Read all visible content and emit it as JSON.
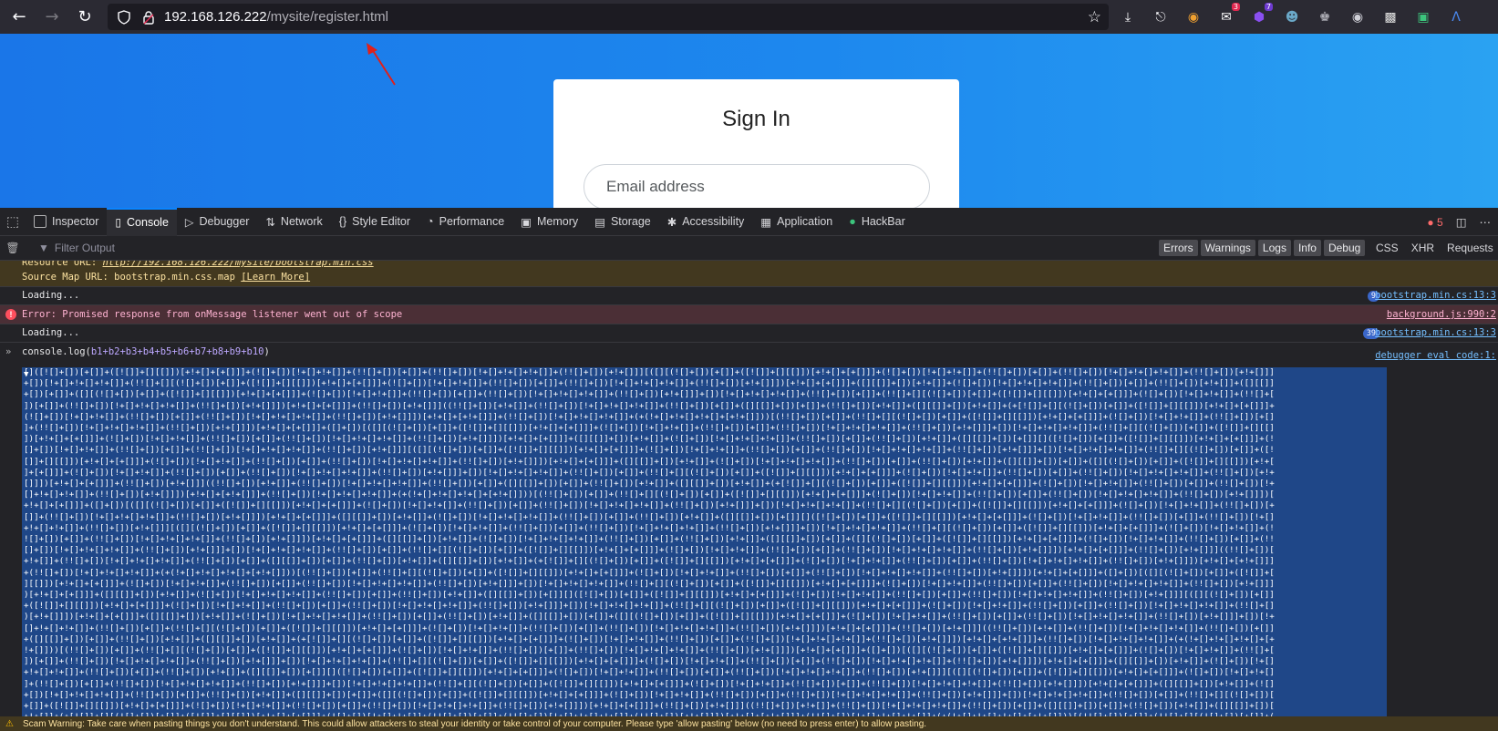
{
  "browser": {
    "url_host": "192.168.126.222",
    "url_path": "/mysite/register.html",
    "extensions": [
      {
        "icon": "fox-icon"
      },
      {
        "icon": "mail-icon",
        "badge": "3"
      },
      {
        "icon": "shield-icon",
        "badge": "7"
      },
      {
        "icon": "mask-icon"
      },
      {
        "icon": "puzzle-icon"
      },
      {
        "icon": "globe-icon"
      },
      {
        "icon": "cookie-icon"
      },
      {
        "icon": "code-icon"
      },
      {
        "icon": "translate-icon"
      }
    ]
  },
  "page": {
    "card_title": "Sign In",
    "email_placeholder": "Email address"
  },
  "devtools": {
    "tabs": [
      "Inspector",
      "Console",
      "Debugger",
      "Network",
      "Style Editor",
      "Performance",
      "Memory",
      "Storage",
      "Accessibility",
      "Application",
      "HackBar"
    ],
    "active_tab": "Console",
    "error_count": "5",
    "filter_placeholder": "Filter Output",
    "levels": [
      "Errors",
      "Warnings",
      "Logs",
      "Info",
      "Debug"
    ],
    "net_filters": [
      "CSS",
      "XHR",
      "Requests"
    ]
  },
  "console": {
    "warn_line1_label": "Resource URL: ",
    "warn_line1_url": "http://192.168.126.222/mysite/bootstrap.min.css",
    "warn_line2": "Source Map URL: bootstrap.min.css.map ",
    "warn_learn_more": "[Learn More]",
    "loading1": "Loading...",
    "loading1_count": "9",
    "loading1_src": "bootstrap.min.cs:13:3",
    "error_msg": "Error: Promised response from onMessage listener went out of scope",
    "error_src": "background.js:990:2",
    "loading2": "Loading...",
    "loading2_count": "39",
    "loading2_src": "bootstrap.min.cs:13:3",
    "command_fn": "console.log(",
    "command_args": "b1+b2+b3+b4+b5+b6+b7+b8+b9+b10",
    "command_close": ")",
    "output_src": "debugger eval code:1:",
    "output_text": "[]([![]+[])[+[]]+([![]]+[][[]])[+!+[]+[+[]]]+(![]+[])[!+[]+!+[]]+(!![]+[])[+[]]+(!![]+[])[!+[]+!+[]+!+[]]+(!![]+[])[+!+[]]][([][(![]+[])[+[]]+([![]]+[][[]])[+!+[]+[+[]]]+(![]+[])[!+[]+!+[]]+(!![]+[])[+[]]+(!![]+[])[!+[]+!+[]+!+[]]+(!![]+[])[+!+[]]]+[])[!+[]+!+[]+!+[]]+(!![]+[][(![]+[])[+[]]+([![]]+[][[]])[+!+[]+[+[]]]+(![]+[])[!+[]+!+[]]+(!![]+[])[+[]]+(!![]+[])[!+[]+!+[]+!+[]]+(!![]+[])[+!+[]]])[+!+[]+[+[]]]+([][[]]+[])[+!+[]]+(![]+[])[!+[]+!+[]+!+[]]+(!![]+[])[+[]]+(!![]+[])[+!+[]]+([][[]]+[])[+[]]+([][(![]+[])[+[]]+([![]]+[][[]])[+!+[]+[+[]]]+(![]+[])[!+[]+!+[]]+(!![]+[])[+[]]+(!![]+[])[!+[]+!+[]+!+[]]+(!![]+[])[+!+[]]]+[])[!+[]+!+[]+!+[]]+(!![]+[])[+[]]+(!![]+[][(![]+[])[+[]]+([![]]+[][[]])[+!+[]+[+[]]]+(![]+[])[!+[]+!+[]]+(!![]+[])[+[]]+(!![]+[])[!+[]+!+[]+!+[]]+(!![]+[])[+!+[]]])[+!+[]+[+[]]]+(!![]+[])[+!+[]]]((!![]+[])[+!+[]]+(!![]+[])[!+[]+!+[]+!+[]]+(!![]+[])[+[]]+([][[]]+[])[+[]]+(!![]+[])[+!+[]]+([][[]]+[])[+!+[]]+(+[![]]+[][(![]+[])[+[]]+([![]]+[][[]])[+!+[]+[+[]]]+(![]+[])[!+[]+!+[]]+(!![]+[])[+[]]+(!![]+[])[!+[]+!+[]+!+[]]+(!![]+[])[+!+[]]])[+!+[]+[+!+[]]]+(!![]+[])[!+[]+!+[]+!+[]]+(+(!+[]+!+[]+!+[]+[+!+[]]))[(!![]+[])[+[]]+(!![]+[][(![]+[])[+[]]+([![]]+[][[]])[+!+[]+[+[]]]+(![]+[])[!+[]+!+[]]+(!![]+[])[+[]]+(!![]+[])[!+[]+!+[]+!+[]]+(!![]+[])[+!+[]]])[+!+[]+[+[]]]+([]+[])[([][(![]+[])[+[]]+([![]]+[][[]])[+!+[]+[+[]]]+(![]+[])[!+[]+!+[]]+(!![]+[])[+[]]+(!![]+[])[!+[]+!+[]+!+[]]+(!![]+[])[+!+[]]]+[])[!+[]+!+[]+!+[]]+(!![]+[][(![]+[])[+[]]+([![]]+[][[]])[+!+[]+[+[]]]+(![]+[])[!+[]+!+[]]+(!![]+[])[+[]]+(!![]+[])[!+[]+!+[]+!+[]]+(!![]+[])[+!+[]]])[+!+[]+[+[]]]+([][[]]+[])[+!+[]]+(![]+[])[!+[]+!+[]+!+[]]+(!![]+[])[+[]]+(!![]+[])[+!+[]]+([][[]]+[])[+[]]"
  },
  "scam_warning": "Scam Warning: Take care when pasting things you don't understand. This could allow attackers to steal your identity or take control of your computer. Please type 'allow pasting' below (no need to press enter) to allow pasting."
}
